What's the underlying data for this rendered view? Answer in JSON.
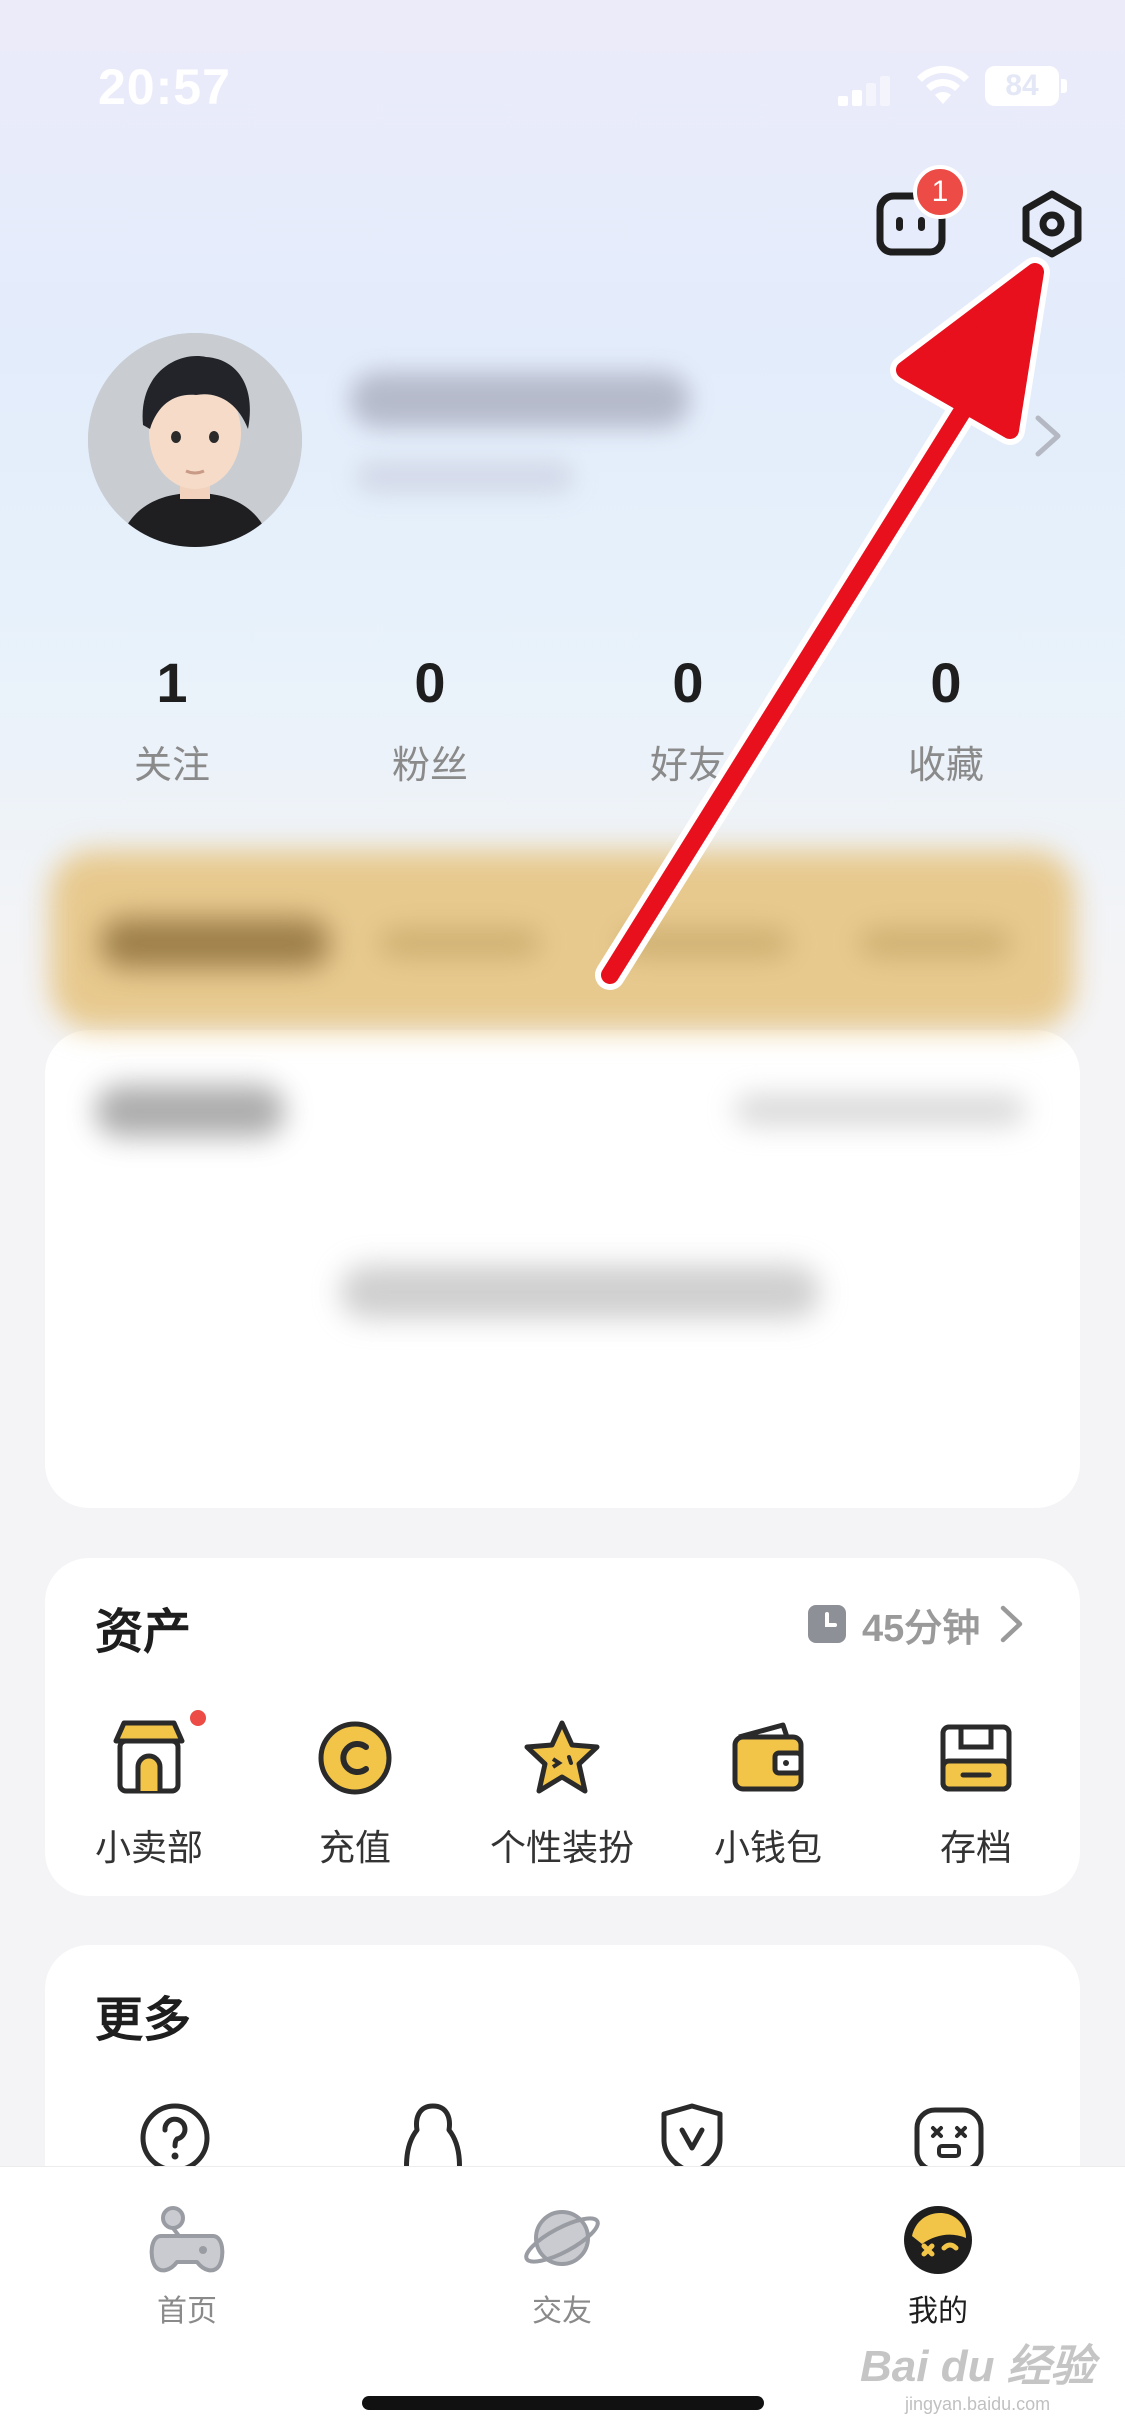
{
  "status_bar": {
    "time": "20:57",
    "battery": "84"
  },
  "header": {
    "message_badge": "1"
  },
  "stats": [
    {
      "value": "1",
      "label": "关注"
    },
    {
      "value": "0",
      "label": "粉丝"
    },
    {
      "value": "0",
      "label": "好友"
    },
    {
      "value": "0",
      "label": "收藏"
    }
  ],
  "assets": {
    "title": "资产",
    "timer": "45分钟",
    "items": [
      {
        "label": "小卖部",
        "icon": "shop-icon"
      },
      {
        "label": "充值",
        "icon": "coin-icon"
      },
      {
        "label": "个性装扮",
        "icon": "star-icon"
      },
      {
        "label": "小钱包",
        "icon": "wallet-icon"
      },
      {
        "label": "存档",
        "icon": "save-icon"
      }
    ]
  },
  "more": {
    "title": "更多",
    "icons": [
      "help-icon",
      "person-icon",
      "shield-icon",
      "robot-icon"
    ]
  },
  "tabs": [
    {
      "label": "首页",
      "icon": "game-icon",
      "active": false
    },
    {
      "label": "交友",
      "icon": "planet-icon",
      "active": false
    },
    {
      "label": "我的",
      "icon": "me-icon",
      "active": true
    }
  ],
  "watermark": {
    "brand": "Bai du 经验",
    "url": "jingyan.baidu.com"
  },
  "colors": {
    "accent_red": "#ec4b46",
    "arrow_red": "#e8101c",
    "text_dark": "#1e1e1e",
    "text_gray": "#8a8a8a"
  }
}
